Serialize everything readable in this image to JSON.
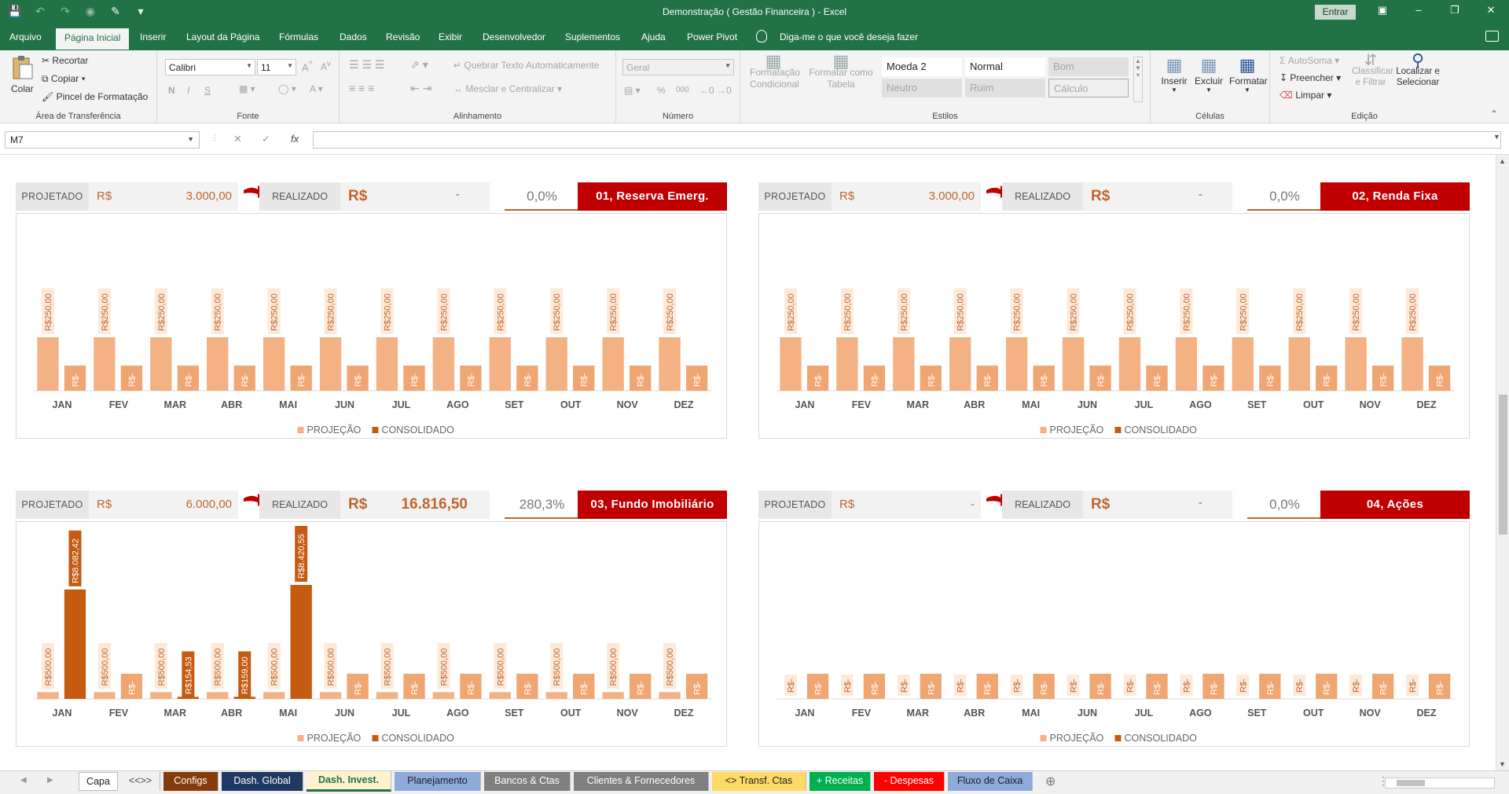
{
  "window": {
    "title": "Demonstração ( Gestão Financeira )  -  Excel",
    "signin": "Entrar"
  },
  "menu": {
    "tabs": [
      "Arquivo",
      "Página Inicial",
      "Inserir",
      "Layout da Página",
      "Fórmulas",
      "Dados",
      "Revisão",
      "Exibir",
      "Desenvolvedor",
      "Suplementos",
      "Ajuda",
      "Power Pivot"
    ],
    "active": "Página Inicial",
    "tellme": "Diga-me o que você deseja fazer"
  },
  "ribbon": {
    "clipboard": {
      "paste": "Colar",
      "cut": "Recortar",
      "copy": "Copiar",
      "painter": "Pincel de Formatação",
      "label": "Área de Transferência"
    },
    "font": {
      "name": "Calibri",
      "size": "11",
      "bold": "N",
      "italic": "I",
      "underline": "S",
      "label": "Fonte"
    },
    "alignment": {
      "wrap": "Quebrar Texto Automaticamente",
      "merge": "Mesclar e Centralizar",
      "label": "Alinhamento"
    },
    "number": {
      "format": "Geral",
      "percent": "%",
      "thousands": "000",
      "label": "Número"
    },
    "styles": {
      "cond_format": "Formatação Condicional",
      "as_table": "Formatar como Tabela",
      "cells": [
        "Moeda 2",
        "Normal",
        "Bom",
        "Neutro",
        "Ruim",
        "Cálculo"
      ],
      "label": "Estilos"
    },
    "cells": {
      "insert": "Inserir",
      "delete": "Excluir",
      "format": "Formatar",
      "label": "Células"
    },
    "editing": {
      "autosum": "AutoSoma",
      "fill": "Preencher",
      "clear": "Limpar",
      "sort": "Classificar e Filtrar",
      "find": "Localizar e Selecionar",
      "label": "Edição"
    }
  },
  "formula_bar": {
    "name_box": "M7",
    "fx": "fx",
    "formula": ""
  },
  "colors": {
    "excel_green": "#217346",
    "projection": "#f4b183",
    "consolidated": "#c55a11",
    "title_red": "#c00000",
    "accent_text": "#c0652a"
  },
  "panels": [
    {
      "proj_label": "PROJETADO",
      "currency": "R$",
      "proj_value": "3.000,00",
      "real_label": "REALIZADO",
      "real_currency": "R$",
      "real_value": "-",
      "percent": "0,0%",
      "title": "01,  Reserva Emerg."
    },
    {
      "proj_label": "PROJETADO",
      "currency": "R$",
      "proj_value": "3.000,00",
      "real_label": "REALIZADO",
      "real_currency": "R$",
      "real_value": "-",
      "percent": "0,0%",
      "title": "02,  Renda Fixa"
    },
    {
      "proj_label": "PROJETADO",
      "currency": "R$",
      "proj_value": "6.000,00",
      "real_label": "REALIZADO",
      "real_currency": "R$",
      "real_value": "16.816,50",
      "percent": "280,3%",
      "title": "03,  Fundo Imobiliário"
    },
    {
      "proj_label": "PROJETADO",
      "currency": "R$",
      "proj_value": "-",
      "real_label": "REALIZADO",
      "real_currency": "R$",
      "real_value": "-",
      "percent": "0,0%",
      "title": "04,  Ações"
    }
  ],
  "chart_data": [
    {
      "type": "bar",
      "categories": [
        "JAN",
        "FEV",
        "MAR",
        "ABR",
        "MAI",
        "JUN",
        "JUL",
        "AGO",
        "SET",
        "OUT",
        "NOV",
        "DEZ"
      ],
      "series": [
        {
          "name": "PROJEÇÃO",
          "values": [
            250,
            250,
            250,
            250,
            250,
            250,
            250,
            250,
            250,
            250,
            250,
            250
          ],
          "labels": [
            "R$250,00",
            "R$250,00",
            "R$250,00",
            "R$250,00",
            "R$250,00",
            "R$250,00",
            "R$250,00",
            "R$250,00",
            "R$250,00",
            "R$250,00",
            "R$250,00",
            "R$250,00"
          ]
        },
        {
          "name": "CONSOLIDADO",
          "values": [
            0,
            0,
            0,
            0,
            0,
            0,
            0,
            0,
            0,
            0,
            0,
            0
          ],
          "labels": [
            "R$-",
            "R$-",
            "R$-",
            "R$-",
            "R$-",
            "R$-",
            "R$-",
            "R$-",
            "R$-",
            "R$-",
            "R$-",
            "R$-"
          ]
        }
      ],
      "legend": "bottom"
    },
    {
      "type": "bar",
      "categories": [
        "JAN",
        "FEV",
        "MAR",
        "ABR",
        "MAI",
        "JUN",
        "JUL",
        "AGO",
        "SET",
        "OUT",
        "NOV",
        "DEZ"
      ],
      "series": [
        {
          "name": "PROJEÇÃO",
          "values": [
            250,
            250,
            250,
            250,
            250,
            250,
            250,
            250,
            250,
            250,
            250,
            250
          ],
          "labels": [
            "R$250,00",
            "R$250,00",
            "R$250,00",
            "R$250,00",
            "R$250,00",
            "R$250,00",
            "R$250,00",
            "R$250,00",
            "R$250,00",
            "R$250,00",
            "R$250,00",
            "R$250,00"
          ]
        },
        {
          "name": "CONSOLIDADO",
          "values": [
            0,
            0,
            0,
            0,
            0,
            0,
            0,
            0,
            0,
            0,
            0,
            0
          ],
          "labels": [
            "R$-",
            "R$-",
            "R$-",
            "R$-",
            "R$-",
            "R$-",
            "R$-",
            "R$-",
            "R$-",
            "R$-",
            "R$-",
            "R$-"
          ]
        }
      ],
      "legend": "bottom"
    },
    {
      "type": "bar",
      "categories": [
        "JAN",
        "FEV",
        "MAR",
        "ABR",
        "MAI",
        "JUN",
        "JUL",
        "AGO",
        "SET",
        "OUT",
        "NOV",
        "DEZ"
      ],
      "series": [
        {
          "name": "PROJEÇÃO",
          "values": [
            500,
            500,
            500,
            500,
            500,
            500,
            500,
            500,
            500,
            500,
            500,
            500
          ],
          "labels": [
            "R$500,00",
            "R$500,00",
            "R$500,00",
            "R$500,00",
            "R$500,00",
            "R$500,00",
            "R$500,00",
            "R$500,00",
            "R$500,00",
            "R$500,00",
            "R$500,00",
            "R$500,00"
          ]
        },
        {
          "name": "CONSOLIDADO",
          "values": [
            8082.42,
            0,
            154.53,
            159,
            8420.55,
            0,
            0,
            0,
            0,
            0,
            0,
            0
          ],
          "labels": [
            "R$8.082,42",
            "R$-",
            "R$154,53",
            "R$159,00",
            "R$8.420,55",
            "R$-",
            "R$-",
            "R$-",
            "R$-",
            "R$-",
            "R$-",
            "R$-"
          ]
        }
      ],
      "legend": "bottom"
    },
    {
      "type": "bar",
      "categories": [
        "JAN",
        "FEV",
        "MAR",
        "ABR",
        "MAI",
        "JUN",
        "JUL",
        "AGO",
        "SET",
        "OUT",
        "NOV",
        "DEZ"
      ],
      "series": [
        {
          "name": "PROJEÇÃO",
          "values": [
            0,
            0,
            0,
            0,
            0,
            0,
            0,
            0,
            0,
            0,
            0,
            0
          ],
          "labels": [
            "R$-",
            "R$-",
            "R$-",
            "R$-",
            "R$-",
            "R$-",
            "R$-",
            "R$-",
            "R$-",
            "R$-",
            "R$-",
            "R$-"
          ]
        },
        {
          "name": "CONSOLIDADO",
          "values": [
            0,
            0,
            0,
            0,
            0,
            0,
            0,
            0,
            0,
            0,
            0,
            0
          ],
          "labels": [
            "R$-",
            "R$-",
            "R$-",
            "R$-",
            "R$-",
            "R$-",
            "R$-",
            "R$-",
            "R$-",
            "R$-",
            "R$-",
            "R$-"
          ]
        }
      ],
      "legend": "bottom"
    }
  ],
  "sheet_tabs": [
    {
      "label": "Capa",
      "bg": "#ffffff",
      "fg": "#222222"
    },
    {
      "label": "<<>>",
      "bg": "#f0f0f0",
      "fg": "#444444"
    },
    {
      "label": "Configs",
      "bg": "#843c0c",
      "fg": "#ffffff"
    },
    {
      "label": "Dash. Global",
      "bg": "#1f3864",
      "fg": "#ffffff"
    },
    {
      "label": "Dash. Invest.",
      "bg": "#fff2cc",
      "fg": "#217346",
      "active": true
    },
    {
      "label": "Planejamento",
      "bg": "#8eaadb",
      "fg": "#1f1f1f"
    },
    {
      "label": "Bancos & Ctas",
      "bg": "#808080",
      "fg": "#ffffff"
    },
    {
      "label": "Clientes & Fornecedores",
      "bg": "#808080",
      "fg": "#ffffff"
    },
    {
      "label": "<> Transf. Ctas",
      "bg": "#ffd966",
      "fg": "#222222"
    },
    {
      "label": "+ Receitas",
      "bg": "#00b050",
      "fg": "#ffffff"
    },
    {
      "label": "- Despesas",
      "bg": "#ff0000",
      "fg": "#ffffff"
    },
    {
      "label": "Fluxo de Caixa",
      "bg": "#8eaadb",
      "fg": "#1f1f1f"
    }
  ]
}
